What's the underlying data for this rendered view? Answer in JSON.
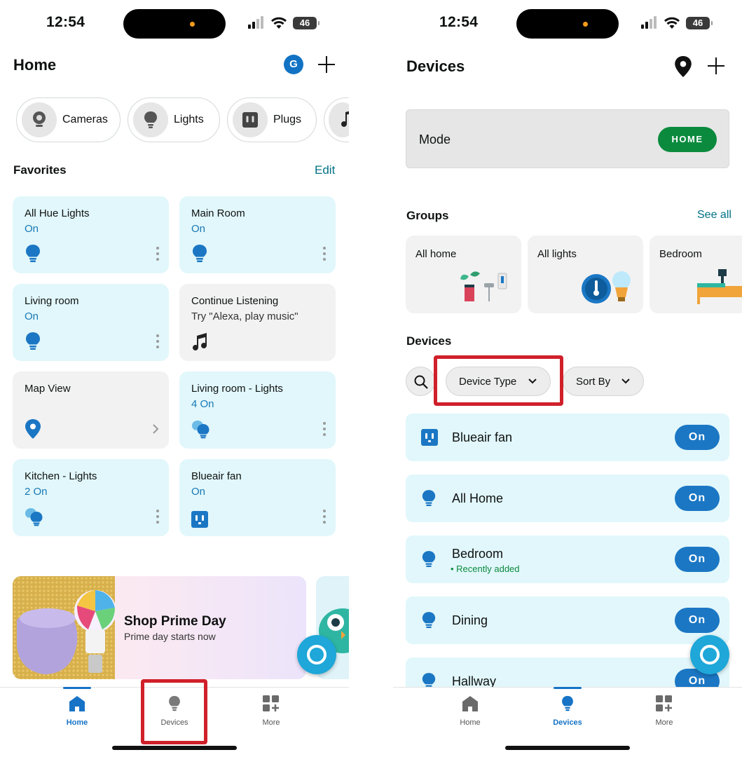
{
  "status": {
    "time": "12:54",
    "battery": "46"
  },
  "left": {
    "header": {
      "title": "Home",
      "avatar": "G",
      "plus_icon": "plus-icon"
    },
    "chips": [
      {
        "label": "Cameras",
        "icon": "camera-icon"
      },
      {
        "label": "Lights",
        "icon": "bulb-icon"
      },
      {
        "label": "Plugs",
        "icon": "plug-icon"
      },
      {
        "label": "",
        "icon": "music-icon"
      }
    ],
    "favorites": {
      "title": "Favorites",
      "edit": "Edit",
      "cards": [
        {
          "title": "All Hue Lights",
          "status": "On",
          "icon": "bulb-icon"
        },
        {
          "title": "Main Room",
          "status": "On",
          "icon": "bulb-icon"
        },
        {
          "title": "Living room",
          "status": "On",
          "icon": "bulb-icon"
        },
        {
          "title": "Continue Listening",
          "status": "Try \"Alexa, play music\"",
          "icon": "music-icon"
        },
        {
          "title": "Map View",
          "status": "",
          "icon": "location-pin-icon"
        },
        {
          "title": "Living room - Lights",
          "status": "4 On",
          "icon": "bulb-group-icon"
        },
        {
          "title": "Kitchen - Lights",
          "status": "2 On",
          "icon": "bulb-group-icon"
        },
        {
          "title": "Blueair fan",
          "status": "On",
          "icon": "plug-icon"
        }
      ]
    },
    "promo": {
      "title": "Shop Prime Day",
      "subtitle": "Prime day starts now"
    },
    "tabs": [
      {
        "label": "Home",
        "active": true
      },
      {
        "label": "Devices",
        "active": false
      },
      {
        "label": "More",
        "active": false
      }
    ]
  },
  "right": {
    "header": {
      "title": "Devices",
      "location_icon": "location-pin-icon",
      "plus_icon": "plus-icon"
    },
    "mode": {
      "label": "Mode",
      "button": "HOME"
    },
    "groups": {
      "title": "Groups",
      "see_all": "See all",
      "items": [
        {
          "label": "All home"
        },
        {
          "label": "All lights"
        },
        {
          "label": "Bedroom"
        }
      ]
    },
    "devices": {
      "title": "Devices",
      "filters": {
        "device_type": "Device Type",
        "sort_by": "Sort By"
      },
      "items": [
        {
          "name": "Blueair fan",
          "sub": "",
          "state": "On",
          "icon": "plug-icon"
        },
        {
          "name": "All Home",
          "sub": "",
          "state": "On",
          "icon": "bulb-icon"
        },
        {
          "name": "Bedroom",
          "sub": "Recently added",
          "state": "On",
          "icon": "bulb-icon"
        },
        {
          "name": "Dining",
          "sub": "",
          "state": "On",
          "icon": "bulb-icon"
        },
        {
          "name": "Hallway",
          "sub": "",
          "state": "On",
          "icon": "bulb-icon"
        }
      ]
    },
    "tabs": [
      {
        "label": "Home",
        "active": false
      },
      {
        "label": "Devices",
        "active": true
      },
      {
        "label": "More",
        "active": false
      }
    ]
  },
  "colors": {
    "accent": "#1673c6",
    "tile": "#e1f7fb",
    "mode_green": "#0b8a3e",
    "highlight_red": "#d0202a",
    "link": "#007185"
  }
}
